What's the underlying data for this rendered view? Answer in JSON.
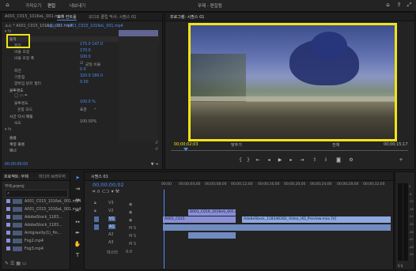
{
  "topbar": {
    "tabs": [
      "홈",
      "가져오기",
      "편집",
      "내보내기"
    ],
    "title": "무제 - 편집됨"
  },
  "source_panel": {
    "tabs": [
      "A001_C015_1016eL_001.mp4",
      "효과 컨트롤",
      "오디오 클립 믹서: 시퀀스 01"
    ]
  },
  "effect_controls": {
    "clip_label": "소스 * A001_C015_1016eL_001.mp4",
    "seq_label": "시퀀스 01 * A001_C015_1016eL_001.mp4",
    "motion_section": "동작",
    "rows": [
      {
        "label": "위치",
        "value": "175.0    147.0"
      },
      {
        "label": "비율 조정",
        "value": "170.0"
      },
      {
        "label": "비율 조정 폭",
        "value": "100.0"
      },
      {
        "label": "균일 비율",
        "value": "균일 비율"
      },
      {
        "label": "회전",
        "value": "0.0"
      },
      {
        "label": "기준점",
        "value": "320.0    180.0"
      },
      {
        "label": "깜박임 방지 필터",
        "value": "0.00"
      }
    ],
    "opacity_section": "불투명도",
    "opacity_rows": [
      {
        "label": "불투명도",
        "value": "100.0 %"
      },
      {
        "label": "혼합 모드",
        "value": "표준"
      }
    ],
    "timeremap_section": "시간 다시 매핑",
    "timeremap_rows": [
      {
        "label": "속도",
        "value": "100.00%"
      }
    ],
    "audio_sections": [
      "볼륨",
      "채널 볼륨",
      "패너"
    ],
    "timecode": "00:00:00:00"
  },
  "program": {
    "tab": "프로그램: 시퀀스 01",
    "timecode": "00;00;02;03",
    "fit": "맞추기",
    "quality": "전체",
    "duration": "00;00;15;17"
  },
  "project": {
    "tabs": [
      "프로젝트: 무제",
      "미디어 브라우저"
    ],
    "file": "무제.prproj",
    "search_placeholder": "",
    "items": [
      {
        "name": "A001_C015_1016eL_001.mp4",
        "color": "#8a8fd8"
      },
      {
        "name": "A001_C015_1016eL_001.mp4",
        "color": "#8a8fd8"
      },
      {
        "name": "AdobeStock_1183...",
        "color": "#8a8fd8"
      },
      {
        "name": "AdobeStock_1183...",
        "color": "#8a8fd8"
      },
      {
        "name": "Antigravity(1)_fin...",
        "color": "#8a8fd8"
      },
      {
        "name": "Fog2.mp4",
        "color": "#8a8fd8"
      },
      {
        "name": "Fog3.mp4",
        "color": "#8a8fd8"
      }
    ]
  },
  "timeline": {
    "tab": "시퀀스 01",
    "timecode": "00;00;00;02",
    "ruler": [
      "00;00",
      "00;00;04;00",
      "00;00;08;00",
      "00;00;12;00",
      "00;00;16;00",
      "00;00;20;00",
      "00;00;24;00",
      "00;00;28;00",
      "00;00;32;00"
    ],
    "tracks": [
      "V3",
      "V2",
      "V1",
      "A1",
      "A2",
      "A3",
      "마스터"
    ],
    "master_value": "0.0",
    "clips": {
      "v2": "B001_C019_1016eS_001.mp4",
      "v1a": "A001_C015",
      "v1b": "AdobeStock_118346282_Video_HD_Preview.mov [V]"
    }
  },
  "audio_meter": {
    "labels": [
      "0",
      "-6",
      "-12",
      "-18",
      "-24",
      "-30",
      "-36",
      "-42",
      "-48",
      "-54"
    ],
    "footer": "S S"
  }
}
